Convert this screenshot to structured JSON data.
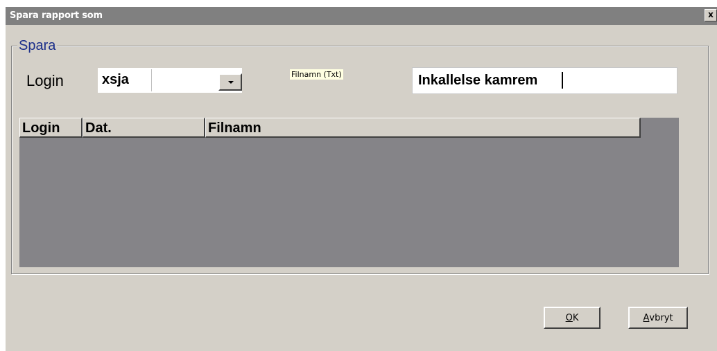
{
  "window": {
    "title": "Spara rapport som",
    "close_label": "x"
  },
  "group": {
    "label": "Spara"
  },
  "login": {
    "label": "Login",
    "value": "xsja"
  },
  "filename": {
    "label": "Filnamn (Txt)",
    "value": "Inkallelse kamrem"
  },
  "grid": {
    "columns": [
      "Login",
      "Dat.",
      "Filnamn"
    ],
    "rows": []
  },
  "buttons": {
    "ok": {
      "mnemonic": "O",
      "rest": "K"
    },
    "cancel": {
      "mnemonic": "A",
      "rest": "vbryt"
    }
  },
  "colors": {
    "title_bar": "#808080",
    "dialog_bg": "#d4d0c8",
    "group_label": "#1a2e8a",
    "grid_bg": "#858488",
    "tooltip_bg": "#ffffe1"
  }
}
